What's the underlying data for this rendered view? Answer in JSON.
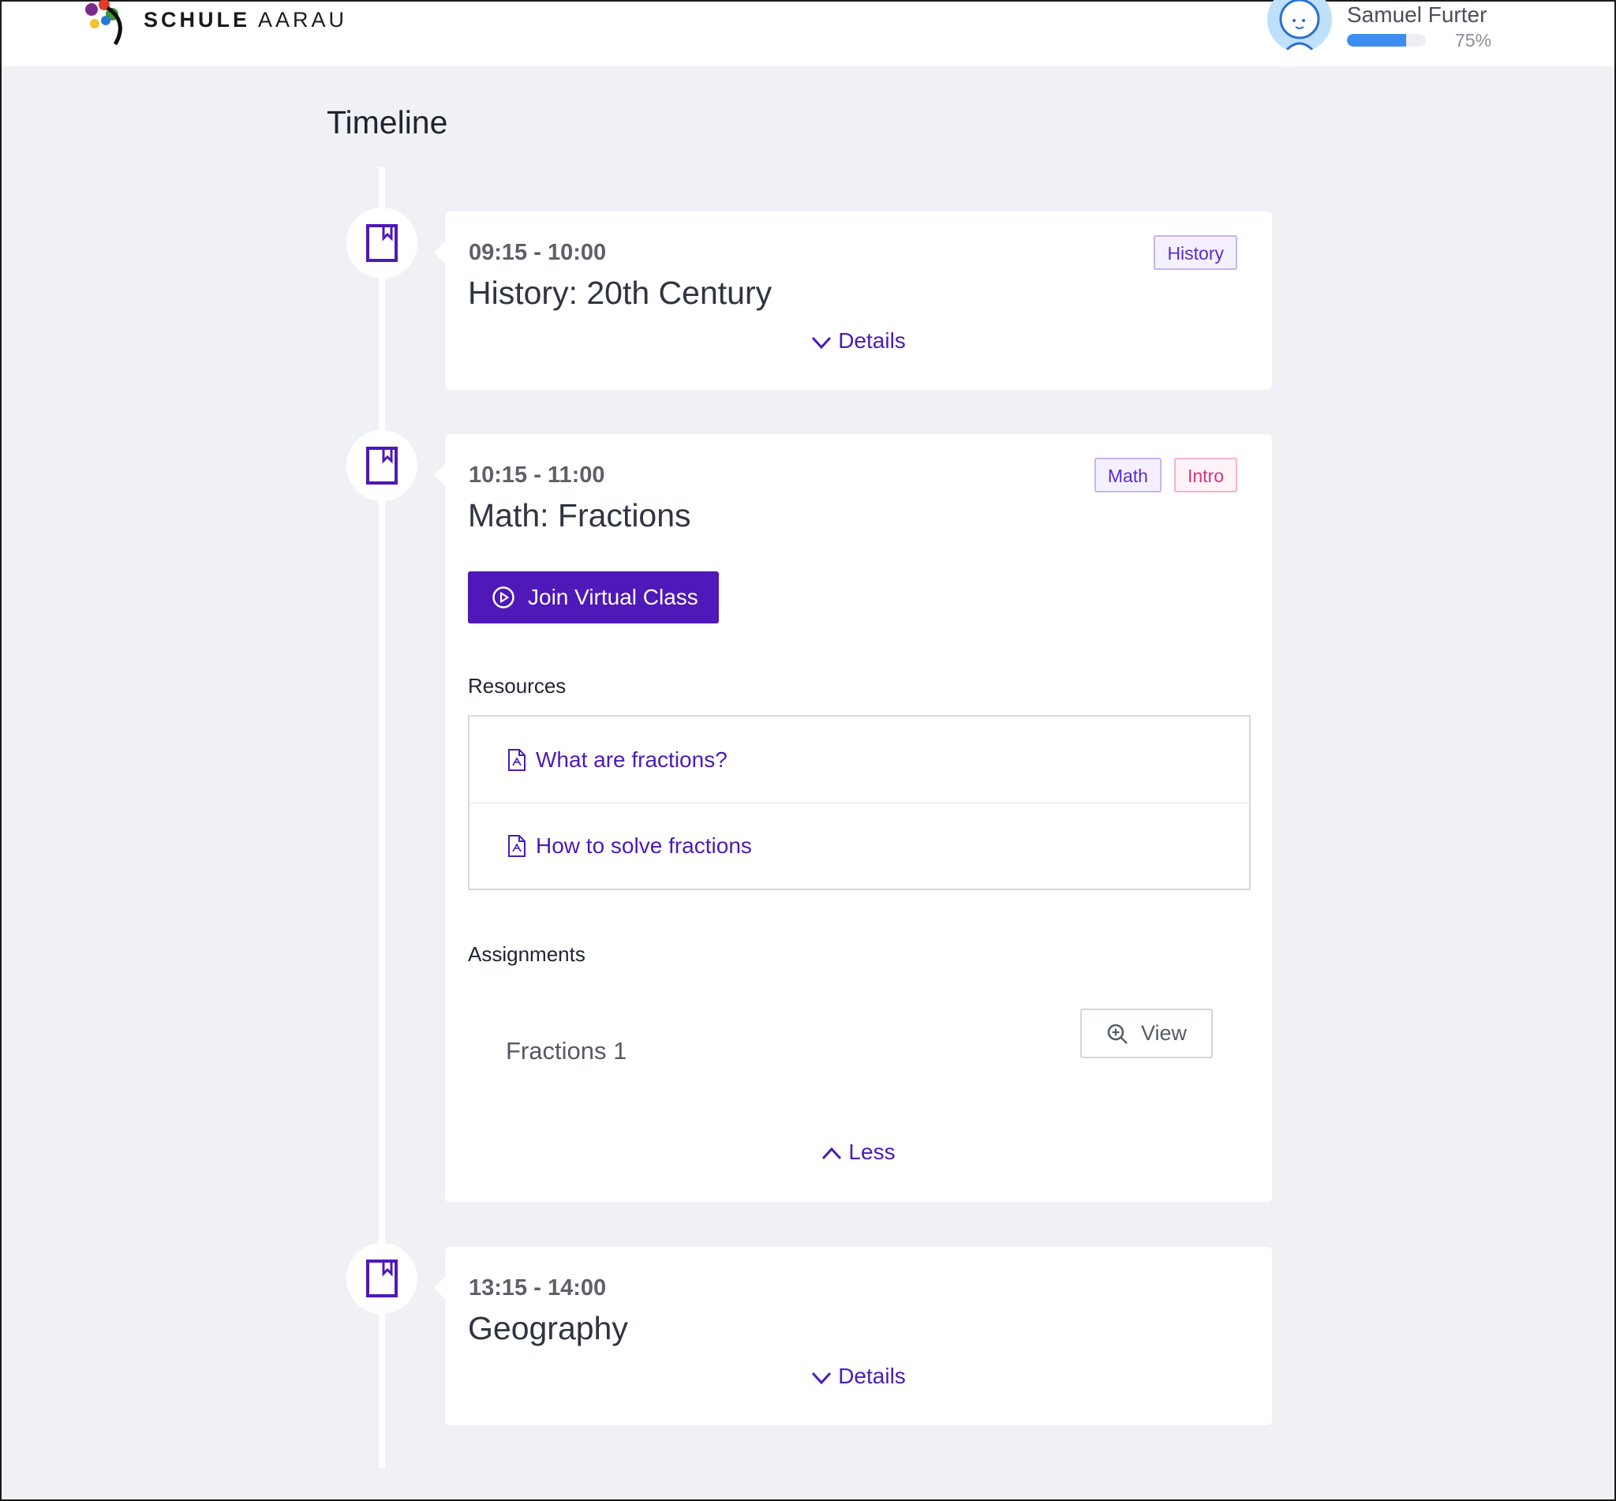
{
  "brand": {
    "name_bold": "SCHULE",
    "name_light": "AARAU"
  },
  "user": {
    "name": "Samuel Furter",
    "progress": 75,
    "progress_label": "75%"
  },
  "page": {
    "title": "Timeline"
  },
  "events": [
    {
      "time": "09:15 - 10:00",
      "title": "History: 20th Century",
      "tags": [
        {
          "label": "History",
          "color": "#5a2cc7"
        }
      ],
      "toggle_label": "Details"
    },
    {
      "time": "10:15 - 11:00",
      "title": "Math: Fractions",
      "tags": [
        {
          "label": "Math",
          "color": "#5a2cc7"
        },
        {
          "label": "Intro",
          "color": "#d6337a"
        }
      ],
      "join_label": "Join Virtual Class",
      "resources_label": "Resources",
      "resources": [
        {
          "label": "What are fractions?"
        },
        {
          "label": "How to solve fractions"
        }
      ],
      "assignments_label": "Assignments",
      "assignments": [
        {
          "name": "Fractions 1",
          "action_label": "View"
        }
      ],
      "toggle_label": "Less"
    },
    {
      "time": "13:15 - 14:00",
      "title": "Geography",
      "tags": [],
      "toggle_label": "Details"
    }
  ],
  "colors": {
    "accent": "#4f18b8",
    "progress": "#3d8ef0",
    "background": "#f0f1f4"
  },
  "icons": [
    "logo-mark",
    "avatar",
    "book-icon",
    "chevron-down-icon",
    "chevron-up-icon",
    "play-circle-icon",
    "pdf-file-icon",
    "zoom-in-icon"
  ]
}
